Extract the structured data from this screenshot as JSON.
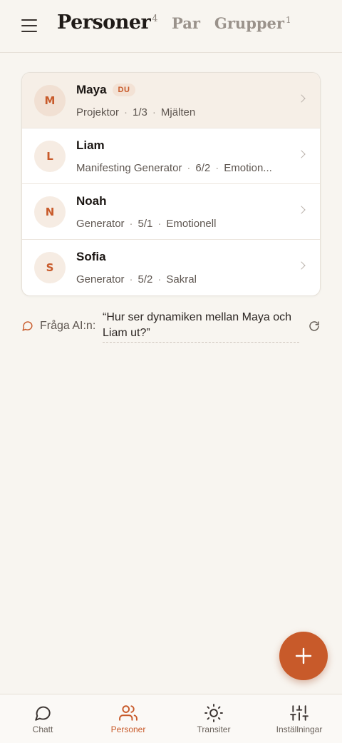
{
  "header": {
    "tabs": [
      {
        "label": "Personer",
        "count": "4",
        "active": true
      },
      {
        "label": "Par",
        "count": "",
        "active": false
      },
      {
        "label": "Grupper",
        "count": "1",
        "active": false
      }
    ]
  },
  "people": [
    {
      "initial": "M",
      "name": "Maya",
      "badge": "DU",
      "type": "Projektor",
      "profile": "1/3",
      "authority": "Mjälten",
      "highlight": true
    },
    {
      "initial": "L",
      "name": "Liam",
      "badge": "",
      "type": "Manifesting Generator",
      "profile": "6/2",
      "authority": "Emotion...",
      "highlight": false
    },
    {
      "initial": "N",
      "name": "Noah",
      "badge": "",
      "type": "Generator",
      "profile": "5/1",
      "authority": "Emotionell",
      "highlight": false
    },
    {
      "initial": "S",
      "name": "Sofia",
      "badge": "",
      "type": "Generator",
      "profile": "5/2",
      "authority": "Sakral",
      "highlight": false
    }
  ],
  "ai": {
    "label": "Fråga AI:n:",
    "prompt": "“Hur ser dynamiken mellan Maya och Liam ut?”"
  },
  "nav": {
    "items": [
      {
        "label": "Chatt",
        "icon": "chat-icon",
        "active": false
      },
      {
        "label": "Personer",
        "icon": "people-icon",
        "active": true
      },
      {
        "label": "Transiter",
        "icon": "sun-icon",
        "active": false
      },
      {
        "label": "Inställningar",
        "icon": "sliders-icon",
        "active": false
      }
    ]
  },
  "colors": {
    "accent": "#c85a2a",
    "background": "#f8f5f0",
    "card": "#ffffff",
    "highlight_row": "#f6efe7"
  }
}
